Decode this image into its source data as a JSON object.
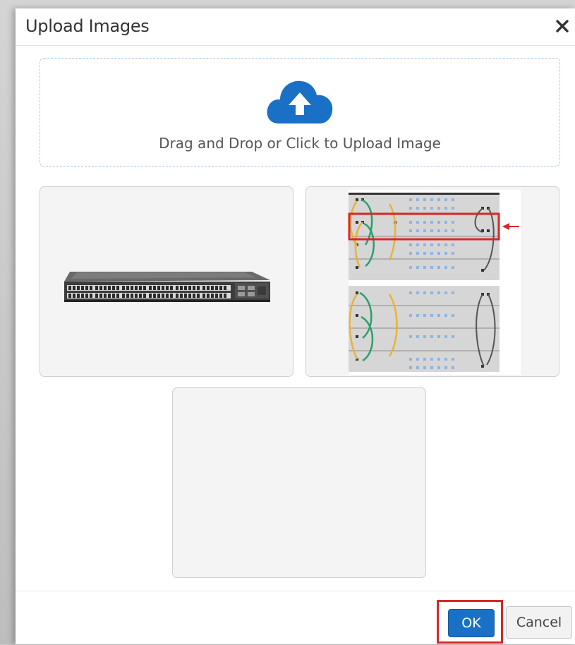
{
  "dialog": {
    "title": "Upload Images",
    "close_icon": "close-icon"
  },
  "dropzone": {
    "icon": "cloud-upload-icon",
    "text": "Drag and Drop or Click to Upload Image"
  },
  "thumbnails": [
    {
      "name": "switch-photo",
      "description_icon": "network-switch-image"
    },
    {
      "name": "rack-diagram",
      "description_icon": "rack-wiring-diagram-image"
    },
    {
      "name": "empty-slot",
      "description_icon": ""
    }
  ],
  "footer": {
    "ok_label": "OK",
    "cancel_label": "Cancel"
  },
  "colors": {
    "primary": "#1a70c4",
    "highlight": "#d92626",
    "cloud": "#1a70c4"
  }
}
